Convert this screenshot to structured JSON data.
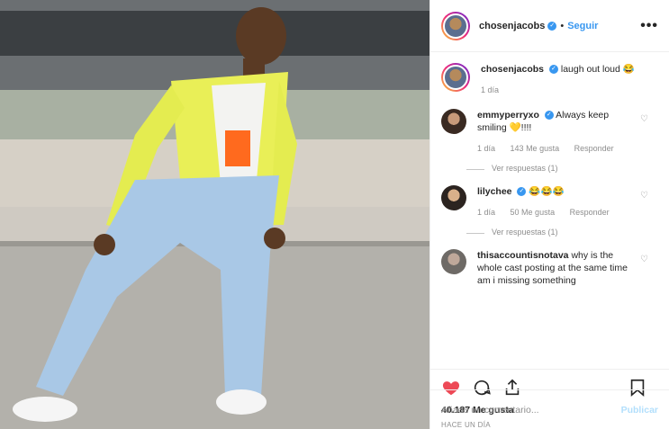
{
  "header": {
    "username": "chosenjacobs",
    "follow_label": "Seguir",
    "more_label": "•••",
    "separator": "•"
  },
  "caption": {
    "username": "chosenjacobs",
    "text": "laugh out loud 😂",
    "time": "1 día"
  },
  "comments": [
    {
      "username": "emmyperryxo",
      "text": "Always keep smiling 💛!!!!",
      "time": "1 día",
      "likes": "143 Me gusta",
      "reply": "Responder",
      "replies": "Ver respuestas (1)"
    },
    {
      "username": "lilychee",
      "text": "😂😂😂",
      "time": "1 día",
      "likes": "50 Me gusta",
      "reply": "Responder",
      "replies": "Ver respuestas (1)"
    },
    {
      "username": "thisaccountisnotava",
      "text": "why is the whole cast posting at the same time am i missing something"
    }
  ],
  "likes_count": "40.187 Me gusta",
  "post_time": "HACE UN DÍA",
  "comment_input": {
    "placeholder": "Añade un comentario...",
    "submit_label": "Publicar"
  },
  "colors": {
    "accent": "#3897f0",
    "like": "#ed4956"
  },
  "icons": [
    "heart-icon",
    "comment-icon",
    "share-icon",
    "bookmark-icon",
    "verified-icon"
  ]
}
